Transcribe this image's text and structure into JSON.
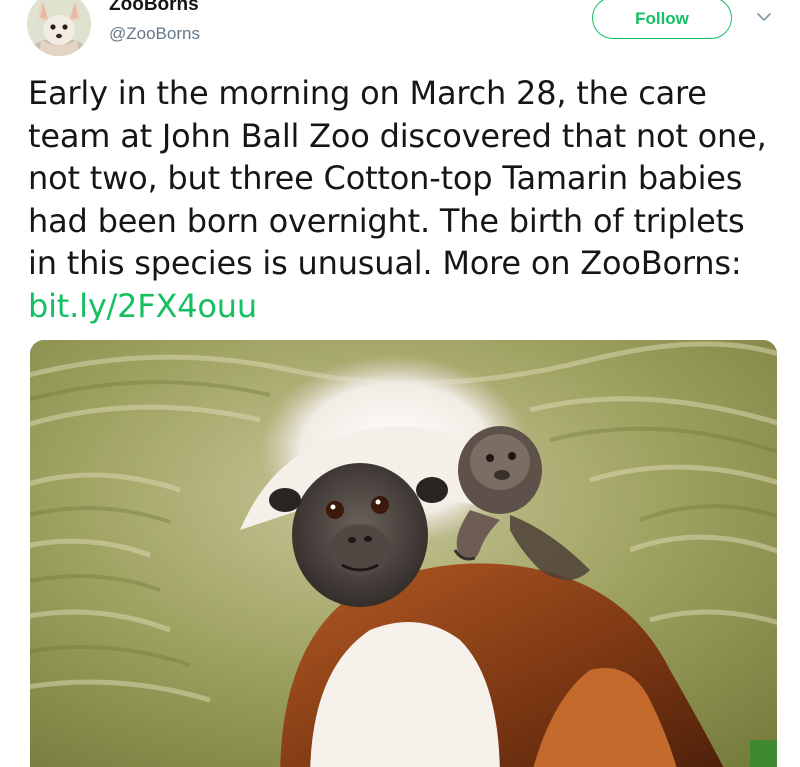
{
  "author": {
    "display_name": "ZooBorns",
    "handle": "@ZooBorns",
    "avatar_icon": "fennec-fox-avatar"
  },
  "actions": {
    "follow_label": "Follow",
    "more_icon": "chevron-down-icon"
  },
  "tweet": {
    "text": "Early in the morning on March 28, the care team at John Ball Zoo discovered that not one, not two, but three Cotton-top Tamarin babies had been born overnight. The birth of triplets in this species is unusual. More on ZooBorns: ",
    "link_text": "bit.ly/2FX4ouu"
  },
  "media": {
    "icon": "cotton-top-tamarin-photo"
  },
  "colors": {
    "accent": "#17bf63",
    "text": "#14171a",
    "secondary": "#657786"
  }
}
